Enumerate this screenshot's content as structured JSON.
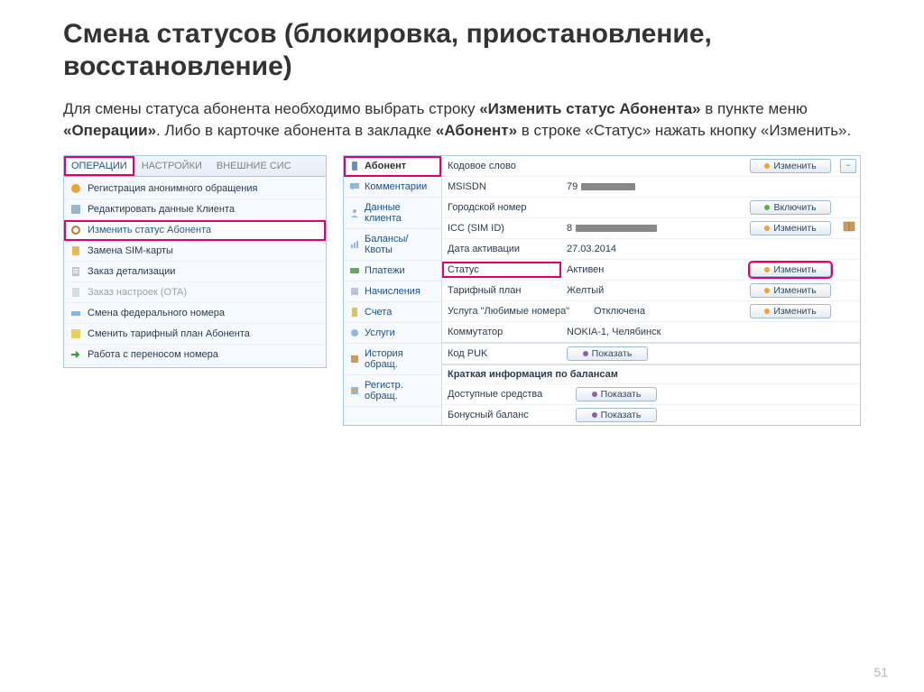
{
  "title": "Смена статусов (блокировка, приостановление, восстановление)",
  "desc": {
    "p1a": "Для смены статуса абонента необходимо выбрать строку ",
    "p1b": "«Изменить статус Абонента»",
    "p1c": " в пункте меню ",
    "p1d": "«Операции»",
    "p1e": ". Либо в карточке абонента в закладке ",
    "p1f": "«Абонент»",
    "p1g": " в строке «Статус» нажать кнопку «Изменить»."
  },
  "left_tabs": {
    "operations": "ОПЕРАЦИИ",
    "settings": "НАСТРОЙКИ",
    "external": "ВНЕШНИЕ СИС"
  },
  "menu": {
    "items": [
      "Регистрация анонимного обращения",
      "Редактировать данные Клиента",
      "Изменить статус Абонента",
      "Замена SIM-карты",
      "Заказ детализации",
      "Заказ настроек (OTA)",
      "Смена федерального номера",
      "Сменить тарифный план Абонента",
      "Работа с переносом номера"
    ]
  },
  "sidebar": {
    "items": [
      "Абонент",
      "Комментарии",
      "Данные клиента",
      "Балансы/Квоты",
      "Платежи",
      "Начисления",
      "Счета",
      "Услуги",
      "История обращ.",
      "Регистр. обращ."
    ]
  },
  "card": {
    "rows": [
      {
        "label": "Кодовое слово",
        "value": "",
        "btn": "Изменить",
        "btn_icon": "edit"
      },
      {
        "label": "MSISDN",
        "value_prefix": "79",
        "redact": true
      },
      {
        "label": "Городской номер",
        "value": "",
        "btn": "Включить",
        "btn_icon": "add"
      },
      {
        "label": "ICC (SIM ID)",
        "value_prefix": "8",
        "redact": true,
        "btn": "Изменить",
        "btn_icon": "edit",
        "extra_icon": "book"
      },
      {
        "label": "Дата активации",
        "value": "27.03.2014"
      },
      {
        "label": "Статус",
        "value": "Активен",
        "btn": "Изменить",
        "btn_icon": "edit",
        "highlight": true
      },
      {
        "label": "Тарифный план",
        "value": "Желтый",
        "btn": "Изменить",
        "btn_icon": "edit"
      },
      {
        "label": "Услуга \"Любимые номера\"",
        "value": "Отключена",
        "btn": "Изменить",
        "btn_icon": "edit"
      },
      {
        "label": "Коммутатор",
        "value": "NOKIA-1, Челябинск"
      }
    ],
    "puk": {
      "label": "Код PUK",
      "btn": "Показать"
    },
    "balances_header": "Краткая информация по балансам",
    "balances": [
      {
        "label": "Доступные средства",
        "btn": "Показать"
      },
      {
        "label": "Бонусный баланс",
        "btn": "Показать"
      }
    ]
  },
  "collapse": "−",
  "pagenum": "51",
  "colors": {
    "edit": "#e7a43a",
    "add": "#5fae4a",
    "show": "#8a5fae"
  }
}
